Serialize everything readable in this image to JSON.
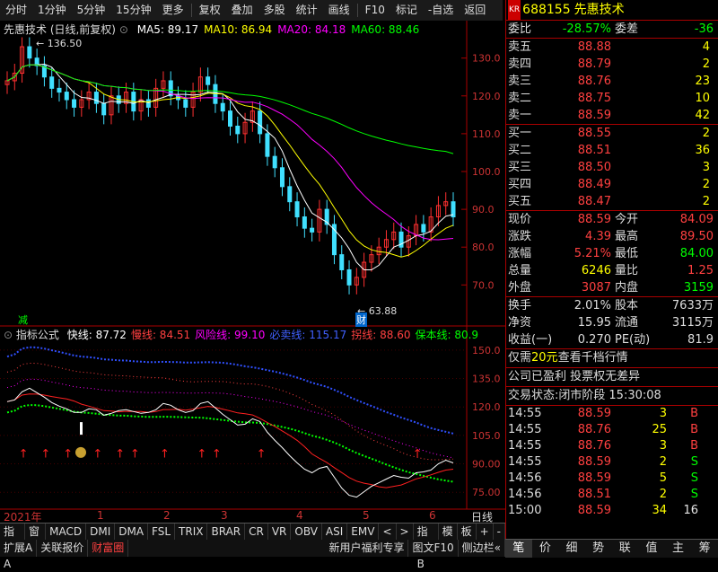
{
  "toolbar": {
    "items": [
      "分时",
      "1分钟",
      "5分钟",
      "15分钟",
      "更多",
      "复权",
      "叠加",
      "多股",
      "统计",
      "画线",
      "F10",
      "标记",
      "-自选",
      "返回"
    ]
  },
  "stock": {
    "title": "先惠技术 (日线,前复权)",
    "ma_labels": [
      {
        "text": "MA5: 89.17",
        "color": "#ffffff"
      },
      {
        "text": "MA10: 86.94",
        "color": "#ffff00"
      },
      {
        "text": "MA20: 84.18",
        "color": "#ff00ff"
      },
      {
        "text": "MA60: 88.46",
        "color": "#00ff00"
      }
    ],
    "high_mark": "136.50",
    "low_mark": "63.88",
    "price_ticks": [
      "130.0",
      "120.0",
      "110.0",
      "100.0",
      "90.0",
      "80.0",
      "70.0"
    ],
    "jian": "减",
    "cai": "财"
  },
  "indicator": {
    "title": "指标公式",
    "labels": [
      {
        "text": "快线: 87.72",
        "color": "#ffffff"
      },
      {
        "text": "慢线: 84.51",
        "color": "#ff4040"
      },
      {
        "text": "风险线: 99.10",
        "color": "#ff00ff"
      },
      {
        "text": "必卖线: 115.17",
        "color": "#4060ff"
      },
      {
        "text": "拐线: 88.60",
        "color": "#ff4040"
      },
      {
        "text": "保本线: 80.9",
        "color": "#00ff00"
      }
    ],
    "ticks": [
      "150.0",
      "135.0",
      "120.0",
      "105.0",
      "90.00",
      "75.00"
    ]
  },
  "xaxis": {
    "labels": [
      "2021年",
      "1",
      "2",
      "3",
      "4",
      "5",
      "6"
    ],
    "period": "日线"
  },
  "tabs_row1": [
    "指标A",
    "窗口",
    "MACD",
    "DMI",
    "DMA",
    "FSL",
    "TRIX",
    "BRAR",
    "CR",
    "VR",
    "OBV",
    "ASI",
    "EMV",
    "<",
    ">",
    "指标B",
    "模",
    "板",
    "+",
    "-"
  ],
  "tabs_row2": [
    "扩展A",
    "关联报价",
    "财富圈",
    "新用户福利专享",
    "图文F10",
    "侧边栏«"
  ],
  "quote": {
    "kr": "KR",
    "code": "688155",
    "name": "先惠技术",
    "weibi_label": "委比",
    "weibi": "-28.57%",
    "weicha_label": "委差",
    "weicha": "-36",
    "sells": [
      {
        "label": "卖五",
        "price": "88.88",
        "vol": "4"
      },
      {
        "label": "卖四",
        "price": "88.79",
        "vol": "2"
      },
      {
        "label": "卖三",
        "price": "88.76",
        "vol": "23"
      },
      {
        "label": "卖二",
        "price": "88.75",
        "vol": "10"
      },
      {
        "label": "卖一",
        "price": "88.59",
        "vol": "42"
      }
    ],
    "buys": [
      {
        "label": "买一",
        "price": "88.55",
        "vol": "2"
      },
      {
        "label": "买二",
        "price": "88.51",
        "vol": "36"
      },
      {
        "label": "买三",
        "price": "88.50",
        "vol": "3"
      },
      {
        "label": "买四",
        "price": "88.49",
        "vol": "2"
      },
      {
        "label": "买五",
        "price": "88.47",
        "vol": "2"
      }
    ],
    "stats": [
      {
        "l1": "现价",
        "v1": "88.59",
        "c1": "red",
        "l2": "今开",
        "v2": "84.09",
        "c2": "red"
      },
      {
        "l1": "涨跌",
        "v1": "4.39",
        "c1": "red",
        "l2": "最高",
        "v2": "89.50",
        "c2": "red"
      },
      {
        "l1": "涨幅",
        "v1": "5.21%",
        "c1": "red",
        "l2": "最低",
        "v2": "84.00",
        "c2": "green"
      },
      {
        "l1": "总量",
        "v1": "6246",
        "c1": "yellow",
        "l2": "量比",
        "v2": "1.25",
        "c2": "red"
      },
      {
        "l1": "外盘",
        "v1": "3087",
        "c1": "red",
        "l2": "内盘",
        "v2": "3159",
        "c2": "green"
      }
    ],
    "stats2": [
      {
        "l1": "换手",
        "v1": "2.01%",
        "l2": "股本",
        "v2": "7633万"
      },
      {
        "l1": "净资",
        "v1": "15.95",
        "l2": "流通",
        "v2": "3115万"
      },
      {
        "l1": "收益(一)",
        "v1": "0.270",
        "l2": "PE(动)",
        "v2": "81.9"
      }
    ],
    "promo1_a": "仅需",
    "promo1_b": "20元",
    "promo1_c": "查看千档行情",
    "promo2": "公司已盈利 投票权无差异",
    "status_label": "交易状态:",
    "status": "闭市阶段",
    "status_time": "15:30:08",
    "ticks": [
      {
        "t": "14:55",
        "p": "88.59",
        "v": "3",
        "s": "B"
      },
      {
        "t": "14:55",
        "p": "88.76",
        "v": "25",
        "s": "B"
      },
      {
        "t": "14:55",
        "p": "88.76",
        "v": "3",
        "s": "B"
      },
      {
        "t": "14:55",
        "p": "88.59",
        "v": "2",
        "s": "S"
      },
      {
        "t": "14:56",
        "p": "88.59",
        "v": "5",
        "s": "S"
      },
      {
        "t": "14:56",
        "p": "88.51",
        "v": "2",
        "s": "S"
      },
      {
        "t": "15:00",
        "p": "88.59",
        "v": "34",
        "s": "16"
      }
    ],
    "bottom_tabs": [
      "笔",
      "价",
      "细",
      "势",
      "联",
      "值",
      "主",
      "筹"
    ]
  },
  "chart_data": {
    "type": "line",
    "title": "先惠技术 (日线,前复权)",
    "ylim": [
      62,
      138
    ],
    "ma_last": {
      "MA5": 89.17,
      "MA10": 86.94,
      "MA20": 84.18,
      "MA60": 88.46
    },
    "high": 136.5,
    "low": 63.88,
    "close_series": [
      124,
      126,
      133,
      130,
      128,
      125,
      122,
      121,
      119,
      117,
      119,
      121,
      118,
      115,
      120,
      118,
      121,
      116,
      119,
      117,
      122,
      124,
      120,
      119,
      117,
      121,
      125,
      123,
      118,
      116,
      112,
      110,
      113,
      116,
      110,
      104,
      101,
      96,
      92,
      88,
      85,
      84,
      90,
      86,
      78,
      74,
      70,
      72,
      76,
      78,
      80,
      82,
      84,
      80,
      83,
      86,
      84,
      88,
      91,
      92,
      88
    ]
  }
}
